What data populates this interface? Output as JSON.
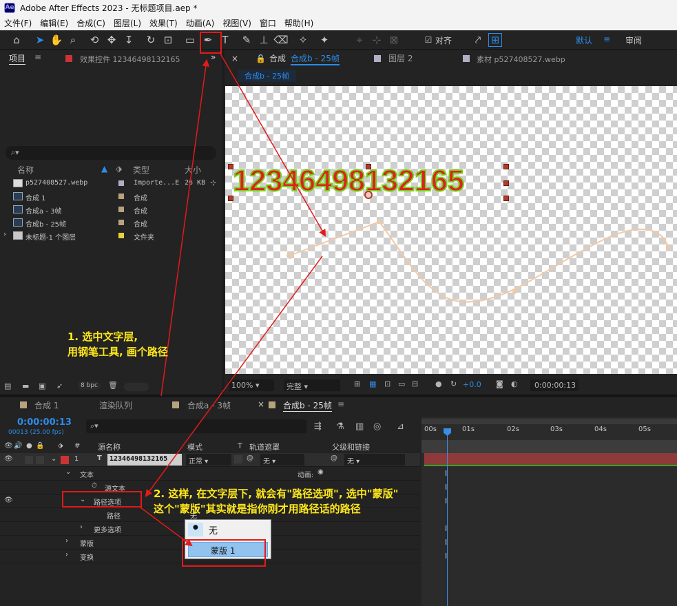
{
  "window": {
    "logo": "Ae",
    "title": "Adobe After Effects 2023 - 无标题项目.aep *"
  },
  "menu": [
    "文件(F)",
    "编辑(E)",
    "合成(C)",
    "图层(L)",
    "效果(T)",
    "动画(A)",
    "视图(V)",
    "窗口",
    "帮助(H)"
  ],
  "toolbar": {
    "snap_label": "对齐",
    "workspace_default": "默认",
    "workspace_review": "审阅",
    "menu_icon": "≡"
  },
  "project_panel": {
    "tab_project": "项目",
    "tab_effects": "效果控件 12346498132165",
    "more": "»",
    "search_icon": "⌕▾",
    "columns": {
      "name": "名称",
      "type": "类型",
      "size": "大小"
    },
    "items": [
      {
        "name": "p527408527.webp",
        "type": "Importe...E",
        "size": "26 KB",
        "label_color": "#b2aec5"
      },
      {
        "name": "合成 1",
        "type": "合成",
        "size": "",
        "label_color": "#b8a37e"
      },
      {
        "name": "合成a - 3帧",
        "type": "合成",
        "size": "",
        "label_color": "#b8a37e"
      },
      {
        "name": "合成b - 25帧",
        "type": "合成",
        "size": "",
        "label_color": "#b8a37e"
      },
      {
        "name": "未标题-1 个图层",
        "type": "文件夹",
        "size": "",
        "label_color": "#e6d23c"
      }
    ],
    "bpc": "8 bpc"
  },
  "viewer": {
    "tab_prefix": "合成",
    "tab_comp": "合成b - 25帧",
    "tab_layer": "图层 2",
    "tab_footage": "素材 p527408527.webp",
    "breadcrumb": "合成b - 25帧",
    "canvas_text": "12346498132165",
    "zoom": "100%",
    "resolution": "完整",
    "exposure": "+0.0",
    "timecode": "0:00:00:13"
  },
  "timeline": {
    "tabs": [
      "合成 1",
      "渲染队列",
      "合成a - 3帧",
      "合成b - 25帧"
    ],
    "current_time": "0:00:00:13",
    "frame_info": "00013 (25.00 fps)",
    "columns": {
      "hash": "#",
      "source_name": "源名称",
      "mode": "模式",
      "t": "T",
      "track_matte": "轨道遮罩",
      "parent": "父级和链接"
    },
    "layer": {
      "index": "1",
      "type_glyph": "T",
      "name": "12346498132165",
      "mode": "正常",
      "matte": "无",
      "parent": "无"
    },
    "props": {
      "text": "文本",
      "animate": "动画:",
      "source_text": "源文本",
      "path_options": "路径选项",
      "path": "路径",
      "path_value": "无",
      "more_options": "更多选项",
      "masks": "蒙版",
      "transform": "变换"
    },
    "ruler": [
      "00s",
      "01s",
      "02s",
      "03s",
      "04s",
      "05s"
    ]
  },
  "dropdown": {
    "options": [
      "无",
      "蒙版 1"
    ],
    "selected_index": 1
  },
  "annotations": {
    "note1": [
      "1. 选中文字层,",
      "用钢笔工具, 画个路径"
    ],
    "note2": [
      "2. 这样, 在文字层下, 就会有\"路径选项\", 选中\"蒙版\"",
      "这个\"蒙版\"其实就是指你刚才用路径话的路径"
    ]
  },
  "colors": {
    "accent": "#2d8ceb",
    "annotation": "#ffe81a",
    "annotation_box": "#e31a1a",
    "layer_bar": "#8e3a3a",
    "text_fill": "#e0201f",
    "text_stroke": "#76d21b"
  }
}
